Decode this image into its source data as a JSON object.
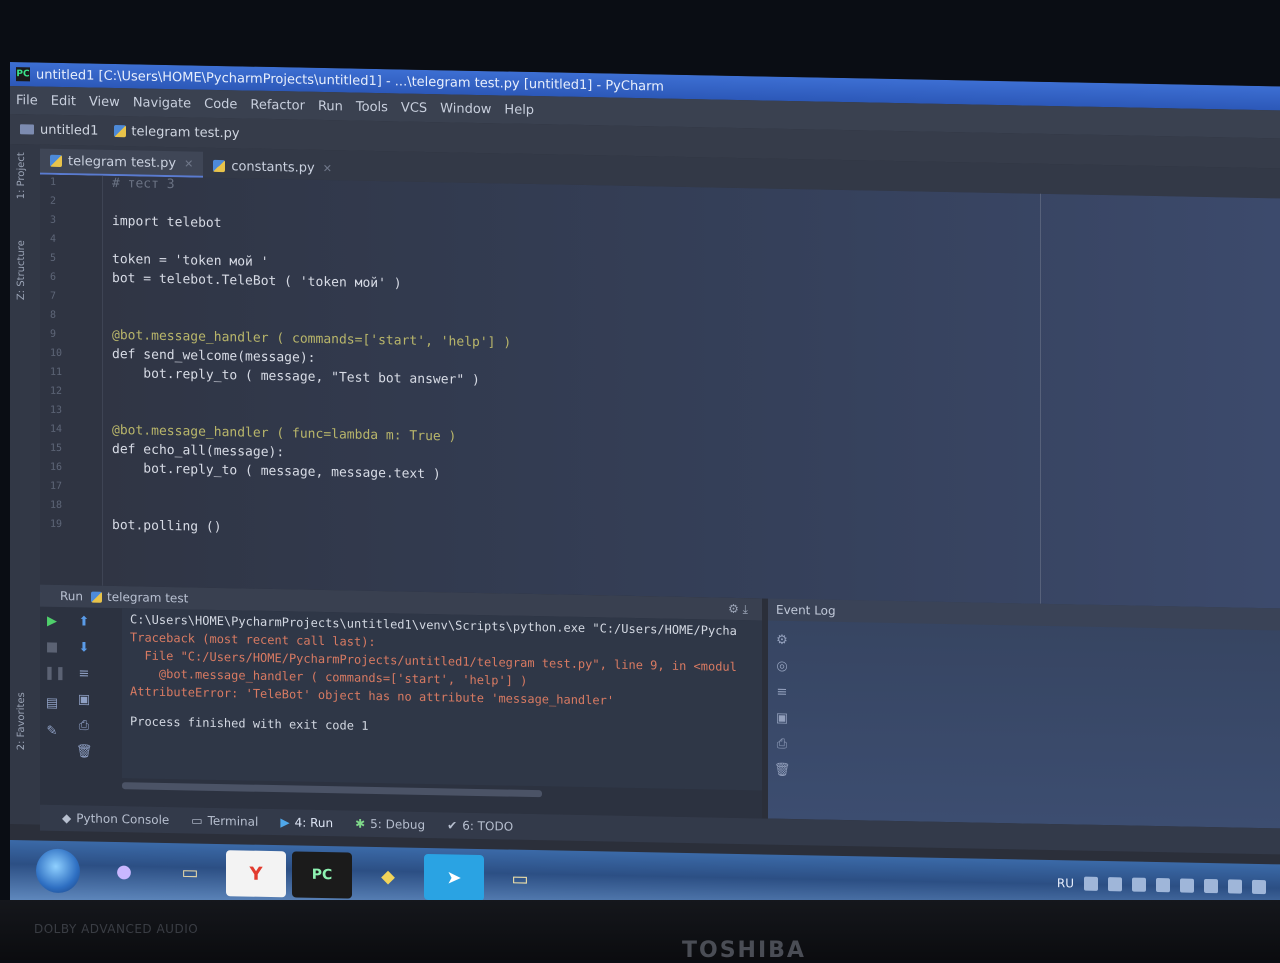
{
  "window": {
    "title": "untitled1 [C:\\Users\\HOME\\PycharmProjects\\untitled1] - ...\\telegram test.py [untitled1] - PyCharm",
    "app_icon": "PC"
  },
  "menu": [
    "File",
    "Edit",
    "View",
    "Navigate",
    "Code",
    "Refactor",
    "Run",
    "Tools",
    "VCS",
    "Window",
    "Help"
  ],
  "breadcrumb": {
    "project": "untitled1",
    "file": "telegram test.py"
  },
  "side_tabs": {
    "project": "1: Project",
    "structure": "Z: Structure",
    "favorites": "2: Favorites"
  },
  "editor_tabs": [
    {
      "label": "telegram test.py",
      "active": true
    },
    {
      "label": "constants.py",
      "active": false
    }
  ],
  "editor": {
    "line_numbers": [
      "1",
      "2",
      "3",
      "4",
      "5",
      "6",
      "7",
      "8",
      "9",
      "10",
      "11",
      "12",
      "13",
      "14",
      "15",
      "16",
      "17",
      "18",
      "19"
    ],
    "lines": [
      {
        "n": "1",
        "text": "# тест 3"
      },
      {
        "n": "3",
        "text": "import telebot"
      },
      {
        "n": "5",
        "text": "token = 'token мой '"
      },
      {
        "n": "6",
        "text": "bot = telebot.TeleBot ( 'token мой' )"
      },
      {
        "n": "9",
        "text": "@bot.message_handler ( commands=['start', 'help'] )"
      },
      {
        "n": "10",
        "text": "def send_welcome(message):"
      },
      {
        "n": "11",
        "text": "    bot.reply_to ( message, \"Test bot answer\" )"
      },
      {
        "n": "14",
        "text": "@bot.message_handler ( func=lambda m: True )"
      },
      {
        "n": "15",
        "text": "def echo_all(message):"
      },
      {
        "n": "16",
        "text": "    bot.reply_to ( message, message.text )"
      },
      {
        "n": "19",
        "text": "bot.polling ()"
      }
    ]
  },
  "run_panel": {
    "label": "Run",
    "config": "telegram test",
    "output": [
      "C:\\Users\\HOME\\PycharmProjects\\untitled1\\venv\\Scripts\\python.exe \"C:/Users/HOME/Pycha",
      "Traceback (most recent call last):",
      "  File \"C:/Users/HOME/PycharmProjects/untitled1/telegram test.py\", line 9, in <modul",
      "    @bot.message_handler ( commands=['start', 'help'] )",
      "AttributeError: 'TeleBot' object has no attribute 'message_handler'",
      "Process finished with exit code 1"
    ]
  },
  "event_log": {
    "label": "Event Log"
  },
  "tool_tabs": [
    "Python Console",
    "Terminal",
    "4: Run",
    "5: Debug",
    "6: TODO"
  ],
  "taskbar": {
    "apps": [
      "mic",
      "files",
      "Y",
      "PC",
      "python",
      "telegram",
      "explorer"
    ],
    "lang": "RU"
  },
  "bezel": {
    "dolby": "DOLBY ADVANCED AUDIO",
    "brand": "TOSHIBA"
  }
}
